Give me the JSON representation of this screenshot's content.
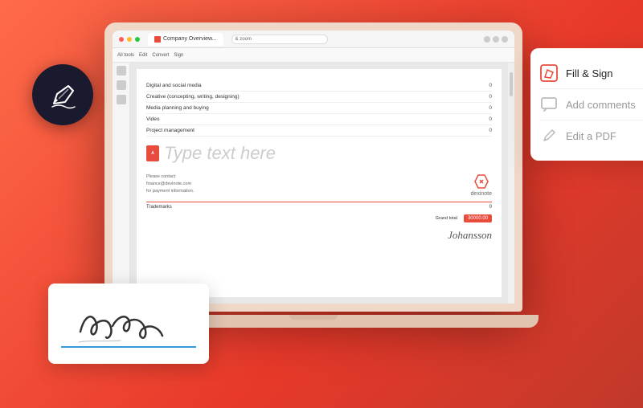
{
  "background": {
    "gradient_start": "#ff6b4a",
    "gradient_end": "#c0392b"
  },
  "browser": {
    "tab_label": "Company Overview...",
    "url": "& zoom",
    "dot_colors": [
      "#ff5f57",
      "#febc2e",
      "#28c840"
    ]
  },
  "toolbar": {
    "items": [
      "All tools",
      "Edit",
      "Convert",
      "Sign"
    ]
  },
  "document": {
    "table_rows": [
      {
        "label": "Digital and social media",
        "value": "0"
      },
      {
        "label": "Creative (concepting, writing, designing)",
        "value": "0"
      },
      {
        "label": "Media planning and buying",
        "value": "0"
      },
      {
        "label": "Video",
        "value": "0"
      },
      {
        "label": "Project management",
        "value": "0"
      }
    ],
    "type_text_placeholder": "Type text here",
    "contact_text": "Please contact\nfinance@devinote.com\nfor payment information.",
    "trademarks_label": "Trademarks",
    "trademarks_value": "0",
    "grand_total_label": "Grand total",
    "grand_total_value": "30000.00",
    "dexinote_label": "dexinote",
    "signature_name": "Johansson"
  },
  "popup_card": {
    "items": [
      {
        "id": "fill-sign",
        "label": "Fill & Sign",
        "muted": false
      },
      {
        "id": "add-comments",
        "label": "Add comments",
        "muted": true
      },
      {
        "id": "edit-pdf",
        "label": "Edit a PDF",
        "muted": true
      }
    ]
  },
  "logo": {
    "symbol": "✒"
  }
}
